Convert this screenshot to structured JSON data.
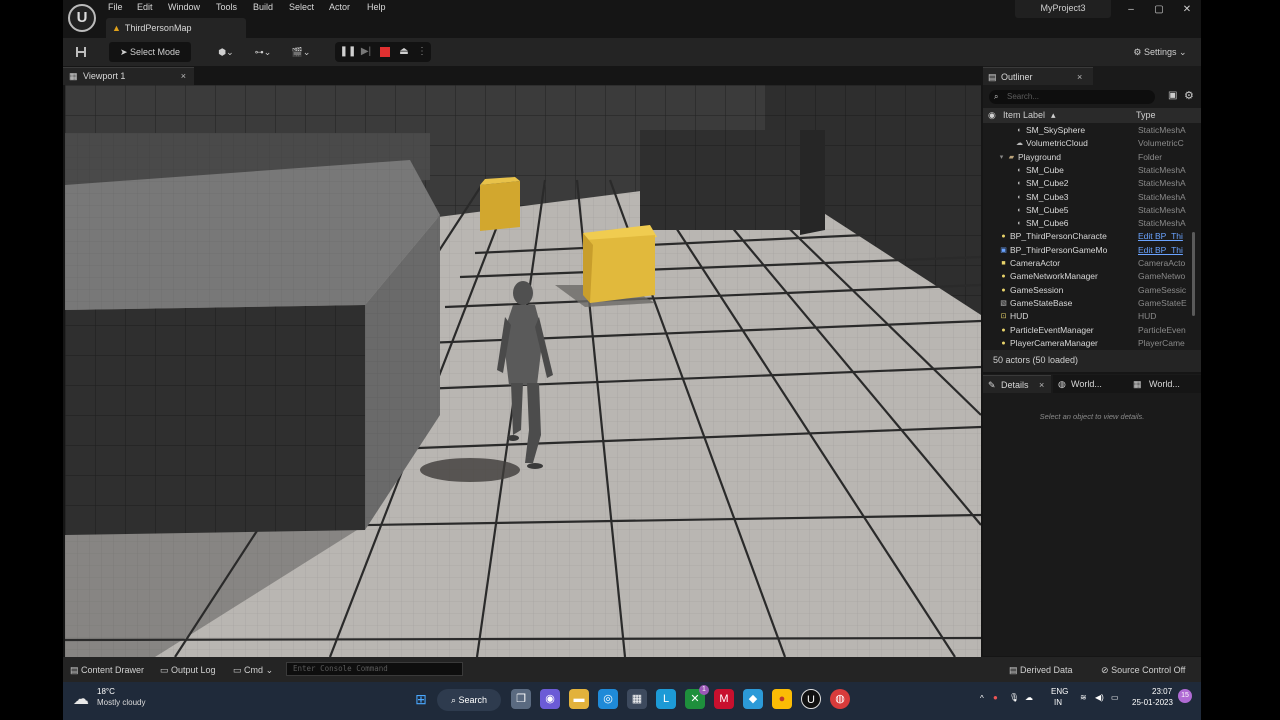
{
  "app": {
    "project_name": "MyProject3",
    "logo_letter": "U",
    "menu": [
      "File",
      "Edit",
      "Window",
      "Tools",
      "Build",
      "Select",
      "Actor",
      "Help"
    ],
    "map_tab": "ThirdPersonMap",
    "window_controls": {
      "minimize": "–",
      "maximize": "▢",
      "close": "✕"
    }
  },
  "toolbar": {
    "select_mode": "Select Mode",
    "settings": "Settings"
  },
  "viewport": {
    "tab_label": "Viewport 1",
    "close": "×"
  },
  "outliner": {
    "tab_label": "Outliner",
    "close": "×",
    "search_placeholder": "Search...",
    "col_label": "Item Label",
    "col_type": "Type",
    "rows": [
      {
        "label": "SM_SkySphere",
        "type": "StaticMeshA",
        "indent": 2,
        "icon": "mesh"
      },
      {
        "label": "VolumetricCloud",
        "type": "VolumetricC",
        "indent": 2,
        "icon": "cloud"
      },
      {
        "label": "Playground",
        "type": "Folder",
        "indent": 1,
        "icon": "folder"
      },
      {
        "label": "SM_Cube",
        "type": "StaticMeshA",
        "indent": 2,
        "icon": "mesh"
      },
      {
        "label": "SM_Cube2",
        "type": "StaticMeshA",
        "indent": 2,
        "icon": "mesh"
      },
      {
        "label": "SM_Cube3",
        "type": "StaticMeshA",
        "indent": 2,
        "icon": "mesh"
      },
      {
        "label": "SM_Cube5",
        "type": "StaticMeshA",
        "indent": 2,
        "icon": "mesh"
      },
      {
        "label": "SM_Cube6",
        "type": "StaticMeshA",
        "indent": 2,
        "icon": "mesh"
      },
      {
        "label": "BP_ThirdPersonCharacte",
        "type": "Edit BP_Thi",
        "indent": 0,
        "icon": "pawn",
        "link": true
      },
      {
        "label": "BP_ThirdPersonGameMo",
        "type": "Edit BP_Thi",
        "indent": 0,
        "icon": "bp",
        "link": true
      },
      {
        "label": "CameraActor",
        "type": "CameraActo",
        "indent": 0,
        "icon": "camera"
      },
      {
        "label": "GameNetworkManager",
        "type": "GameNetwo",
        "indent": 0,
        "icon": "actor"
      },
      {
        "label": "GameSession",
        "type": "GameSessic",
        "indent": 0,
        "icon": "actor"
      },
      {
        "label": "GameStateBase",
        "type": "GameStateE",
        "indent": 0,
        "icon": "box"
      },
      {
        "label": "HUD",
        "type": "HUD",
        "indent": 0,
        "icon": "hud"
      },
      {
        "label": "ParticleEventManager",
        "type": "ParticleEven",
        "indent": 0,
        "icon": "actor"
      },
      {
        "label": "PlayerCameraManager",
        "type": "PlayerCame",
        "indent": 0,
        "icon": "actor"
      }
    ],
    "actors_count": "50 actors (50 loaded)"
  },
  "details": {
    "tabs": [
      "Details",
      "World...",
      "World..."
    ],
    "close": "×",
    "empty_text": "Select an object to view details."
  },
  "statusbar": {
    "content_drawer": "Content Drawer",
    "output_log": "Output Log",
    "cmd": "Cmd",
    "console_placeholder": "Enter Console Command",
    "derived_data": "Derived Data",
    "source_control": "Source Control Off"
  },
  "taskbar": {
    "temperature": "18°C",
    "weather": "Mostly cloudy",
    "search": "Search",
    "lang_top": "ENG",
    "lang_bottom": "IN",
    "time": "23:07",
    "date": "25-01-2023",
    "notifications": "15",
    "teams_badge": "1"
  },
  "colors": {
    "accent_yellow": "#e1b93c",
    "link_blue": "#6aa3ff",
    "stop_red": "#e03030",
    "warning": "#e1a21a"
  }
}
